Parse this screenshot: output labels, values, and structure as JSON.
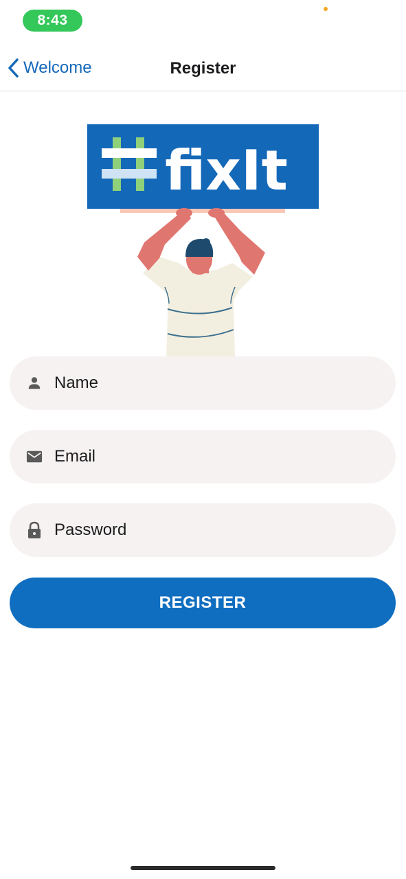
{
  "status_bar": {
    "time": "8:43",
    "time_pill_color": "#34c759"
  },
  "nav": {
    "back_label": "Welcome",
    "title": "Register"
  },
  "illustration": {
    "logo_text": "fixIt",
    "logo_bg_color": "#1468b8",
    "logo_hash_color": "#8fd07a"
  },
  "form": {
    "name": {
      "placeholder": "Name",
      "value": "",
      "icon": "person-icon"
    },
    "email": {
      "placeholder": "Email",
      "value": "",
      "icon": "mail-icon"
    },
    "password": {
      "placeholder": "Password",
      "value": "",
      "icon": "lock-icon"
    }
  },
  "actions": {
    "register_label": "REGISTER",
    "register_color": "#106ec0"
  },
  "colors": {
    "accent": "#1468b8",
    "field_bg": "#f5f2f1"
  }
}
